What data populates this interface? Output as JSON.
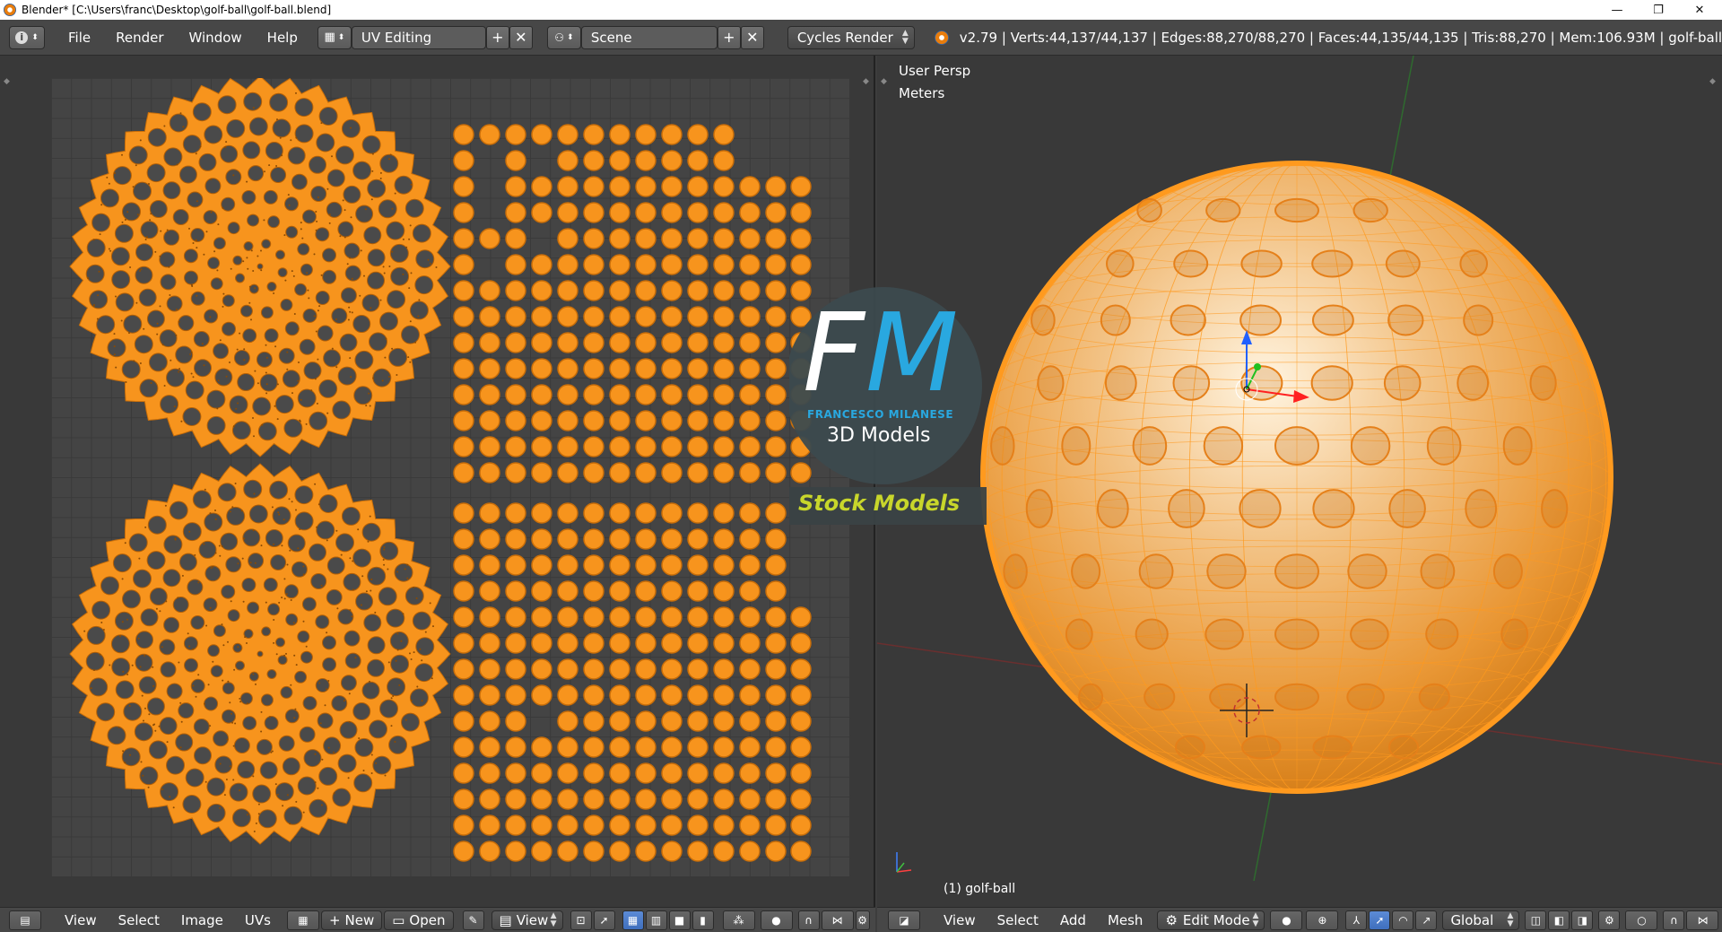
{
  "window": {
    "title": "Blender* [C:\\Users\\franc\\Desktop\\golf-ball\\golf-ball.blend]",
    "controls": {
      "minimize": "—",
      "restore": "❐",
      "close": "✕"
    }
  },
  "infobar": {
    "menus": [
      "File",
      "Render",
      "Window",
      "Help"
    ],
    "screen_layout": "UV Editing",
    "scene": "Scene",
    "render_engine": "Cycles Render",
    "stats": "v2.79 | Verts:44,137/44,137 | Edges:88,270/88,270 | Faces:44,135/44,135 | Tris:88,270 | Mem:106.93M | golf-ball"
  },
  "uv_editor": {
    "menus": [
      "View",
      "Select",
      "Image",
      "UVs"
    ],
    "new_label": "New",
    "open_label": "Open",
    "view_label": "View"
  },
  "viewport": {
    "view_name": "User Persp",
    "units": "Meters",
    "object_label": "(1) golf-ball",
    "menus": [
      "View",
      "Select",
      "Add",
      "Mesh"
    ],
    "mode": "Edit Mode",
    "orientation": "Global"
  },
  "logo": {
    "letters_f": "F",
    "letters_m": "M",
    "name": "FRANCESCO MILANESE",
    "subtitle": "3D Models",
    "banner": "Stock Models"
  },
  "colors": {
    "uv_orange": "#f7941d",
    "mesh_orange": "#ff9a1f",
    "logo_blue": "#29a8e0",
    "banner_text": "#c8d62b"
  }
}
